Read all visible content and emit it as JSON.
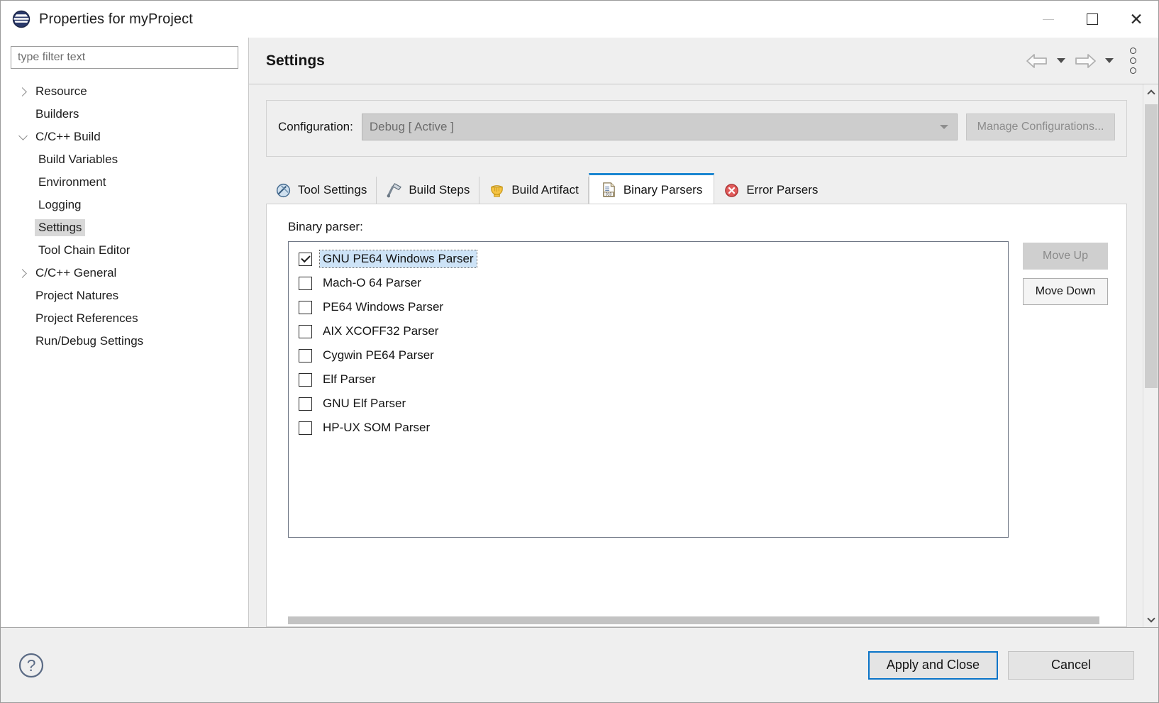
{
  "window": {
    "title": "Properties for myProject",
    "app_icon": "eclipse-icon",
    "controls": {
      "minimize": "minimize-icon",
      "maximize": "maximize-icon",
      "close": "close-icon"
    }
  },
  "sidebar": {
    "filter": {
      "placeholder": "type filter text",
      "value": ""
    },
    "items": [
      {
        "label": "Resource",
        "indent": false,
        "twisty": "collapsed",
        "selected": false
      },
      {
        "label": "Builders",
        "indent": false,
        "twisty": "none",
        "selected": false
      },
      {
        "label": "C/C++ Build",
        "indent": false,
        "twisty": "expanded",
        "selected": false
      },
      {
        "label": "Build Variables",
        "indent": true,
        "twisty": "none",
        "selected": false
      },
      {
        "label": "Environment",
        "indent": true,
        "twisty": "none",
        "selected": false
      },
      {
        "label": "Logging",
        "indent": true,
        "twisty": "none",
        "selected": false
      },
      {
        "label": "Settings",
        "indent": true,
        "twisty": "none",
        "selected": true
      },
      {
        "label": "Tool Chain Editor",
        "indent": true,
        "twisty": "none",
        "selected": false
      },
      {
        "label": "C/C++ General",
        "indent": false,
        "twisty": "collapsed",
        "selected": false
      },
      {
        "label": "Project Natures",
        "indent": false,
        "twisty": "none",
        "selected": false
      },
      {
        "label": "Project References",
        "indent": false,
        "twisty": "none",
        "selected": false
      },
      {
        "label": "Run/Debug Settings",
        "indent": false,
        "twisty": "none",
        "selected": false
      }
    ]
  },
  "header": {
    "title": "Settings",
    "back_icon": "back-arrow-icon",
    "back_dropdown_icon": "chevron-down-icon",
    "forward_icon": "forward-arrow-icon",
    "forward_dropdown_icon": "chevron-down-icon",
    "menu_icon": "view-menu-kebab-icon"
  },
  "configuration": {
    "label": "Configuration:",
    "selected_value": "Debug  [ Active ]",
    "disabled": true,
    "manage_button": "Manage Configurations...",
    "manage_disabled": true,
    "dropdown_icon": "chevron-down-icon"
  },
  "tabs": [
    {
      "label": "Tool Settings",
      "icon": "wrench-screwdriver-icon",
      "active": false
    },
    {
      "label": "Build Steps",
      "icon": "hammer-icon",
      "active": false
    },
    {
      "label": "Build Artifact",
      "icon": "artifact-crown-icon",
      "active": false
    },
    {
      "label": "Binary Parsers",
      "icon": "binary-document-icon",
      "active": true
    },
    {
      "label": "Error Parsers",
      "icon": "error-circle-icon",
      "active": false
    }
  ],
  "binary_parsers": {
    "section_label": "Binary parser:",
    "items": [
      {
        "label": "GNU PE64 Windows Parser",
        "checked": true,
        "selected": true
      },
      {
        "label": "Mach-O 64 Parser",
        "checked": false,
        "selected": false
      },
      {
        "label": "PE64 Windows Parser",
        "checked": false,
        "selected": false
      },
      {
        "label": "AIX XCOFF32 Parser",
        "checked": false,
        "selected": false
      },
      {
        "label": "Cygwin PE64 Parser",
        "checked": false,
        "selected": false
      },
      {
        "label": "Elf Parser",
        "checked": false,
        "selected": false
      },
      {
        "label": "GNU Elf Parser",
        "checked": false,
        "selected": false
      },
      {
        "label": "HP-UX SOM Parser",
        "checked": false,
        "selected": false
      }
    ],
    "move_up": {
      "label": "Move Up",
      "disabled": true
    },
    "move_down": {
      "label": "Move Down",
      "disabled": false
    }
  },
  "scrollbars": {
    "vertical_up_icon": "chevron-up-icon",
    "vertical_down_icon": "chevron-down-icon"
  },
  "footer": {
    "help_icon": "help-question-icon",
    "apply_and_close": "Apply and Close",
    "cancel": "Cancel"
  },
  "colors": {
    "accent_blue": "#0a74c8",
    "tab_active_top": "#1b86d1",
    "selection_blue": "#cde3f7",
    "tree_selection_gray": "#d8d8d8",
    "panel_gray": "#efefef",
    "disabled_text": "#8a8a8a"
  }
}
